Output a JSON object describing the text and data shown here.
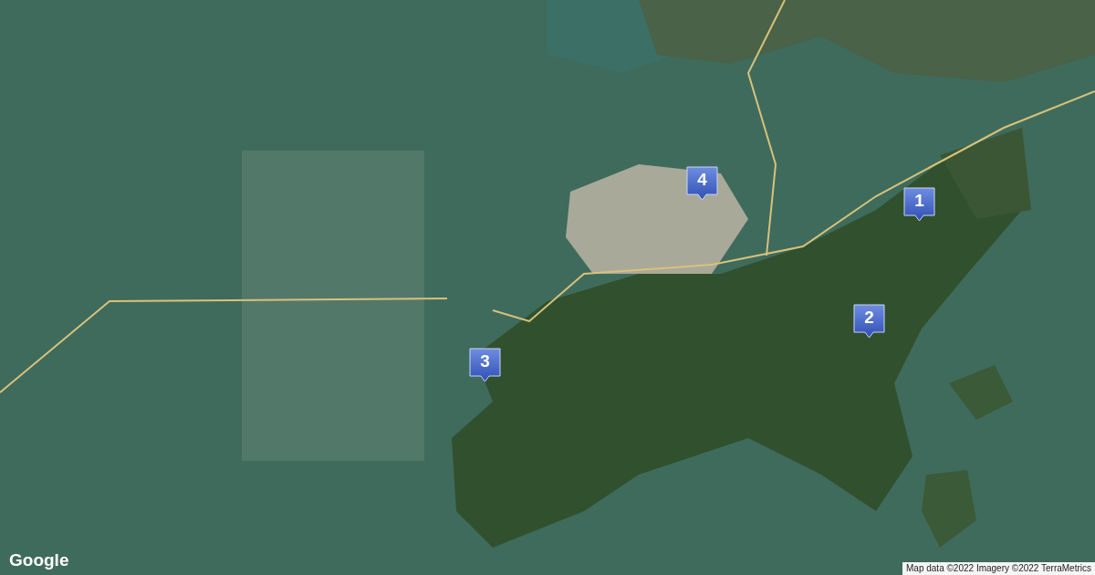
{
  "map": {
    "markers": [
      {
        "label": "1"
      },
      {
        "label": "2"
      },
      {
        "label": "3"
      },
      {
        "label": "4"
      }
    ],
    "logo": "Google",
    "attribution": "Map data ©2022 Imagery ©2022 TerraMetrics"
  }
}
